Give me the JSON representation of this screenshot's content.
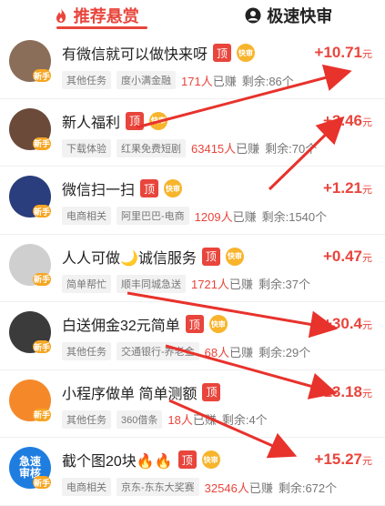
{
  "tabs": [
    {
      "label": "推荐悬赏",
      "icon": "flame-icon",
      "active": true
    },
    {
      "label": "极速快审",
      "icon": "person-icon",
      "active": false
    }
  ],
  "badges": {
    "top": "顶",
    "fast": "快审",
    "new": "新手"
  },
  "tasks": [
    {
      "title": "有微信就可以做快来呀",
      "fast": true,
      "category": "其他任务",
      "sponsor": "度小满金融",
      "earned_count": "171人",
      "earned_suffix": "已赚",
      "remaining": "剩余:86个",
      "price_prefix": "+",
      "price": "10.71",
      "currency": "元",
      "avatar": "#8a6e5a"
    },
    {
      "title": "新人福利",
      "fast": true,
      "category": "下载体验",
      "sponsor": "红果免费短剧",
      "earned_count": "63415人",
      "earned_suffix": "已赚",
      "remaining": "剩余:70个",
      "price_prefix": "+",
      "price": "3.46",
      "currency": "元",
      "avatar": "#6b4a3a"
    },
    {
      "title": "微信扫一扫",
      "fast": true,
      "category": "电商相关",
      "sponsor": "阿里巴巴-电商",
      "earned_count": "1209人",
      "earned_suffix": "已赚",
      "remaining": "剩余:1540个",
      "price_prefix": "+",
      "price": "1.21",
      "currency": "元",
      "avatar": "#2a3d7c"
    },
    {
      "title": "人人可做🌙诚信服务",
      "fast": true,
      "category": "简单帮忙",
      "sponsor": "顺丰同城急送",
      "earned_count": "1721人",
      "earned_suffix": "已赚",
      "remaining": "剩余:37个",
      "price_prefix": "+",
      "price": "0.47",
      "currency": "元",
      "avatar": "#cfcfcf"
    },
    {
      "title": "白送佣金32元简单",
      "fast": true,
      "category": "其他任务",
      "sponsor": "交通银行-养老金",
      "earned_count": "68人",
      "earned_suffix": "已赚",
      "remaining": "剩余:29个",
      "price_prefix": "+",
      "price": "30.4",
      "currency": "元",
      "avatar": "#3b3b3b"
    },
    {
      "title": "小程序做单 简单测额",
      "fast": false,
      "category": "其他任务",
      "sponsor": "360借条",
      "earned_count": "18人",
      "earned_suffix": "已赚",
      "remaining": "剩余:4个",
      "price_prefix": "+",
      "price": "13.18",
      "currency": "元",
      "avatar": "#f5892a"
    },
    {
      "title": "截个图20块🔥🔥",
      "fast": true,
      "category": "电商相关",
      "sponsor": "京东-东东大奖赛",
      "earned_count": "32546人",
      "earned_suffix": "已赚",
      "remaining": "剩余:672个",
      "price_prefix": "+",
      "price": "15.27",
      "currency": "元",
      "avatar": "#1f7de0",
      "avatar_text": "急速审核"
    }
  ],
  "colors": {
    "accent": "#e8453c",
    "fast": "#f7b42c",
    "arrow": "#e8322c"
  }
}
